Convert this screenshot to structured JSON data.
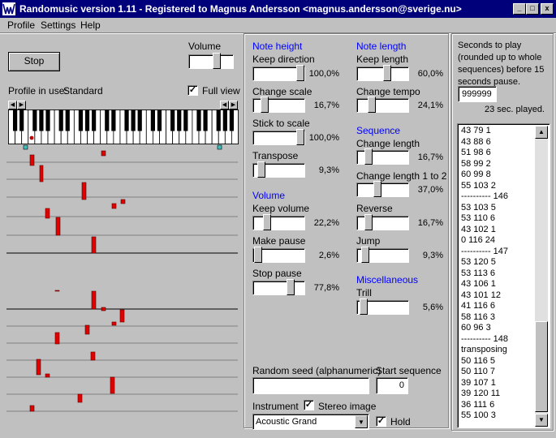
{
  "window": {
    "title": "Randomusic version 1.11 - Registered to Magnus Andersson <magnus.andersson@sverige.nu>",
    "minimize_glyph": "_",
    "maximize_glyph": "□",
    "close_glyph": "x"
  },
  "menu": {
    "items": [
      {
        "label": "Profile"
      },
      {
        "label": "Settings"
      },
      {
        "label": "Help"
      }
    ]
  },
  "left": {
    "stop_label": "Stop",
    "volume_label": "Volume",
    "volume_level": 0.65,
    "profile_label": "Profile in use:",
    "profile_value": "Standard",
    "full_view_label": "Full view",
    "full_view_checked": true
  },
  "note_height": {
    "heading": "Note height",
    "keep_direction": {
      "label": "Keep direction",
      "value": "100,0%",
      "level": 1.0
    },
    "change_scale": {
      "label": "Change scale",
      "value": "16,7%",
      "level": 0.167
    },
    "stick_to_scale": {
      "label": "Stick to scale",
      "value": "100,0%",
      "level": 1.0
    },
    "transpose": {
      "label": "Transpose",
      "value": "9,3%",
      "level": 0.093
    }
  },
  "volume": {
    "heading": "Volume",
    "keep_volume": {
      "label": "Keep volume",
      "value": "22,2%",
      "level": 0.222
    },
    "make_pause": {
      "label": "Make pause",
      "value": "2,6%",
      "level": 0.026
    },
    "stop_pause": {
      "label": "Stop pause",
      "value": "77,8%",
      "level": 0.778
    }
  },
  "note_length": {
    "heading": "Note length",
    "keep_length": {
      "label": "Keep length",
      "value": "60,0%",
      "level": 0.6
    },
    "change_tempo": {
      "label": "Change tempo",
      "value": "24,1%",
      "level": 0.241
    }
  },
  "sequence": {
    "heading": "Sequence",
    "change_length": {
      "label": "Change length",
      "value": "16,7%",
      "level": 0.167
    },
    "change_length_1_to_2": {
      "label": "Change length 1 to 2",
      "value": "37,0%",
      "level": 0.37
    },
    "reverse": {
      "label": "Reverse",
      "value": "16,7%",
      "level": 0.167
    },
    "jump": {
      "label": "Jump",
      "value": "9,3%",
      "level": 0.093
    }
  },
  "misc": {
    "heading": "Miscellaneous",
    "trill": {
      "label": "Trill",
      "value": "5,6%",
      "level": 0.056
    }
  },
  "bottom": {
    "seed_label": "Random seed (alphanumeric)",
    "seed_value": "",
    "start_seq_label": "Start sequence",
    "start_seq_value": "0",
    "instrument_label": "Instrument",
    "stereo_label": "Stereo image",
    "stereo_checked": true,
    "instrument_value": "Acoustic Grand",
    "hold_label": "Hold",
    "hold_checked": true
  },
  "right": {
    "seconds_label": "Seconds to play (rounded up to whole sequences) before 15 seconds pause.",
    "seconds_value": "999999",
    "played_label": "23  sec. played.",
    "list": [
      "43 79 1",
      "43 88 6",
      "51 98 6",
      "58 99 2",
      "60 99 8",
      "55 103 2",
      "---------- 146",
      "53 103 5",
      "53 110 6",
      "43 102 1",
      "0 116 24",
      "---------- 147",
      "53 120 5",
      "53 113 6",
      "43 106 1",
      "43 101 12",
      "41 116 6",
      "58 116 3",
      "60 96 3",
      "---------- 148",
      "transposing",
      "50 116 5",
      "50 110 7",
      "39 107 1",
      "39 120 11",
      "36 111 6",
      "55 100 3"
    ]
  }
}
